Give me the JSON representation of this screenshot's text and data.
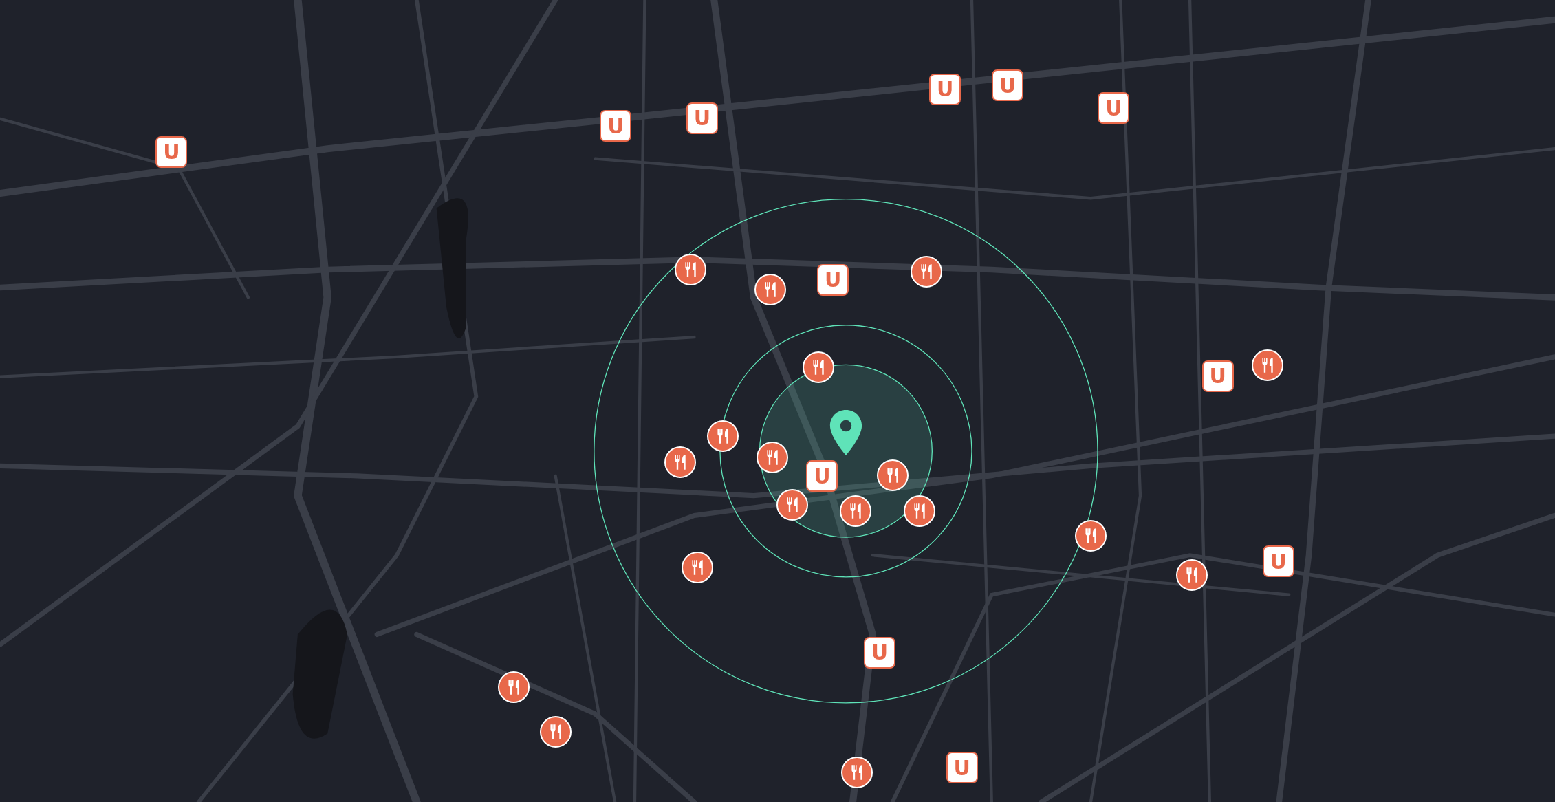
{
  "search_area": {
    "rings": [
      {
        "filled": true
      },
      {
        "filled": false
      },
      {
        "filled": false
      }
    ]
  },
  "markers": [
    {
      "kind": "subway",
      "label": "U"
    },
    {
      "kind": "subway",
      "label": "U"
    },
    {
      "kind": "subway",
      "label": "U"
    },
    {
      "kind": "subway",
      "label": "U"
    },
    {
      "kind": "subway",
      "label": "U"
    },
    {
      "kind": "subway",
      "label": "U"
    },
    {
      "kind": "subway",
      "label": "U"
    },
    {
      "kind": "subway",
      "label": "U"
    },
    {
      "kind": "subway",
      "label": "U"
    },
    {
      "kind": "subway",
      "label": "U"
    },
    {
      "kind": "subway",
      "label": "U"
    },
    {
      "kind": "subway",
      "label": "U"
    },
    {
      "kind": "restaurant"
    },
    {
      "kind": "restaurant"
    },
    {
      "kind": "restaurant"
    },
    {
      "kind": "restaurant"
    },
    {
      "kind": "restaurant"
    },
    {
      "kind": "restaurant"
    },
    {
      "kind": "restaurant"
    },
    {
      "kind": "restaurant"
    },
    {
      "kind": "restaurant"
    },
    {
      "kind": "restaurant"
    },
    {
      "kind": "restaurant"
    },
    {
      "kind": "restaurant"
    },
    {
      "kind": "restaurant"
    },
    {
      "kind": "restaurant"
    },
    {
      "kind": "restaurant"
    },
    {
      "kind": "restaurant"
    },
    {
      "kind": "restaurant"
    },
    {
      "kind": "restaurant"
    }
  ]
}
